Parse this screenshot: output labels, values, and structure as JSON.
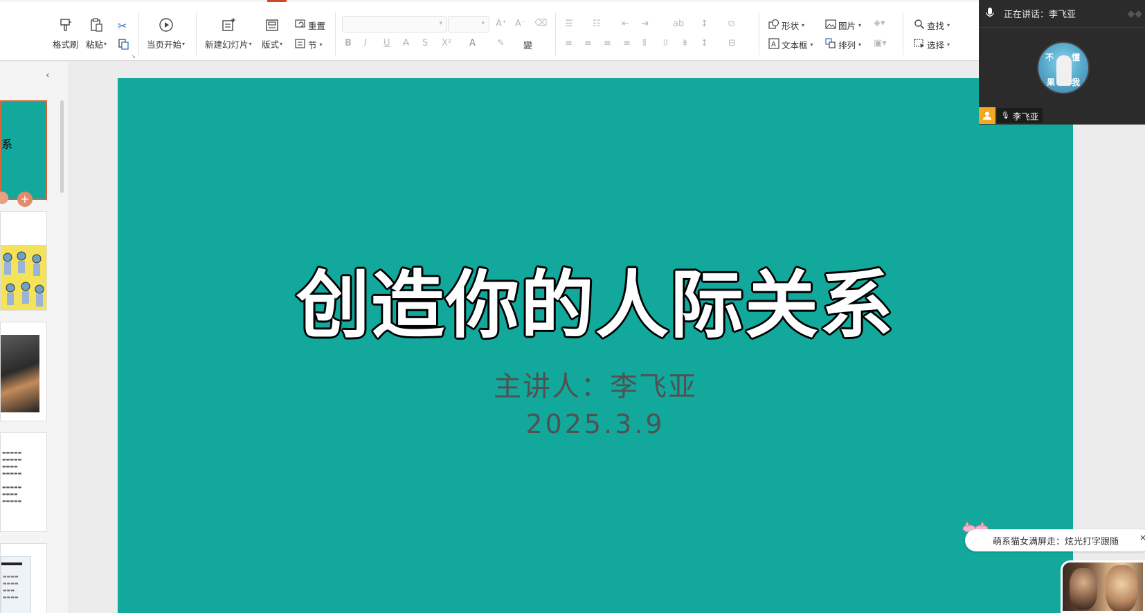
{
  "ribbon": {
    "clipboard": {
      "format_painter": "格式刷",
      "paste": "粘贴"
    },
    "slideshow": {
      "from_current": "当页开始"
    },
    "slides": {
      "new_slide": "新建幻灯片",
      "layout": "版式",
      "reset": "重置",
      "section": "节"
    },
    "drawing": {
      "shape": "形状",
      "picture": "图片",
      "textbox": "文本框",
      "arrange": "排列"
    },
    "editing": {
      "find": "查找",
      "select": "选择"
    }
  },
  "slide": {
    "title": "创造你的人际关系",
    "presenter": "主讲人：李飞亚",
    "date": "2025.3.9"
  },
  "meeting": {
    "speaking_label": "正在讲话：",
    "speaker": "李飞亚",
    "user_name": "李飞亚",
    "avatar_text": [
      "不",
      "懂",
      "果",
      "我"
    ]
  },
  "chat": {
    "message": "萌系猫女满屏走：炫光打字跟随"
  },
  "colors": {
    "slide_bg": "#12a89c",
    "accent": "#d24726",
    "meeting_bg": "#2b2b2b"
  }
}
